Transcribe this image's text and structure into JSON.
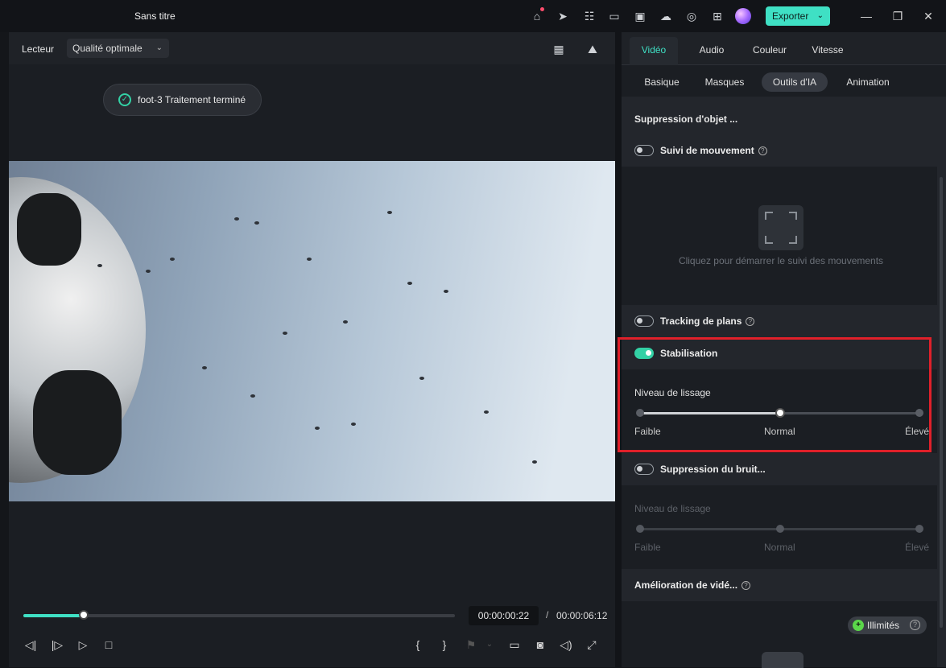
{
  "window": {
    "title": "Sans titre",
    "export_label": "Exporter"
  },
  "titlebar_icons": [
    "gift-icon",
    "send-icon",
    "checklist-icon",
    "layout-icon",
    "save-icon",
    "cloud-upload-icon",
    "headset-icon",
    "grid-icon"
  ],
  "player": {
    "label": "Lecteur",
    "quality": "Qualité optimale",
    "toast": "foot-3 Traitement terminé",
    "progress": 0.14,
    "current_time": "00:00:00:22",
    "separator": "/",
    "total_time": "00:00:06:12"
  },
  "panel": {
    "tabs": [
      "Vidéo",
      "Audio",
      "Couleur",
      "Vitesse"
    ],
    "active_tab": "Vidéo",
    "subtabs": [
      "Basique",
      "Masques",
      "Outils d'IA",
      "Animation"
    ],
    "active_subtab": "Outils d'IA",
    "object_removal": "Suppression d'objet ...",
    "motion_tracking": {
      "label": "Suivi de mouvement",
      "enabled": false,
      "placeholder": "Cliquez pour démarrer le suivi des mouvements"
    },
    "plane_tracking": {
      "label": "Tracking de plans",
      "enabled": false
    },
    "stabilization": {
      "label": "Stabilisation",
      "enabled": true,
      "slider_label": "Niveau de lissage",
      "ticks": [
        "Faible",
        "Normal",
        "Élevé"
      ],
      "value": 0.5
    },
    "noise_removal": {
      "label": "Suppression du bruit...",
      "enabled": false,
      "slider_label": "Niveau de lissage",
      "ticks": [
        "Faible",
        "Normal",
        "Élevé"
      ],
      "value": 0.5
    },
    "video_enhancement": {
      "label": "Amélioration de vidé...",
      "badge": "Illimités"
    }
  },
  "colors": {
    "accent": "#3fe0c4",
    "highlight": "#e0202a"
  }
}
